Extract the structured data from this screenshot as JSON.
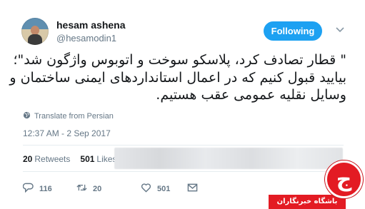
{
  "user": {
    "display_name": "hesam ashena",
    "handle": "@hesamodin1",
    "avatar_icon": "profile-photo"
  },
  "follow": {
    "label": "Following",
    "color": "#1da1f2"
  },
  "tweet": {
    "lines": [
      "\" قطار تصادف کرد، پلاسکو سوخت و اتوبوس واژگون شد\"؛",
      "بیایید قبول کنیم که در اعمال استانداردهای ایمنی ساختمان و",
      "وسایل نقلیه عمومی عقب هستیم."
    ]
  },
  "translate": {
    "label": "Translate from Persian",
    "icon": "globe-icon"
  },
  "timestamp": "12:37 AM - 2 Sep 2017",
  "stats": {
    "retweets_count": "20",
    "retweets_label": "Retweets",
    "likes_count": "501",
    "likes_label": "Likes"
  },
  "actions": {
    "reply_count": "116",
    "retweet_count": "20",
    "like_count": "501"
  },
  "watermark": {
    "text": "باشگاه خبرنگاران",
    "glyph": "ج",
    "color": "#e31b23"
  }
}
